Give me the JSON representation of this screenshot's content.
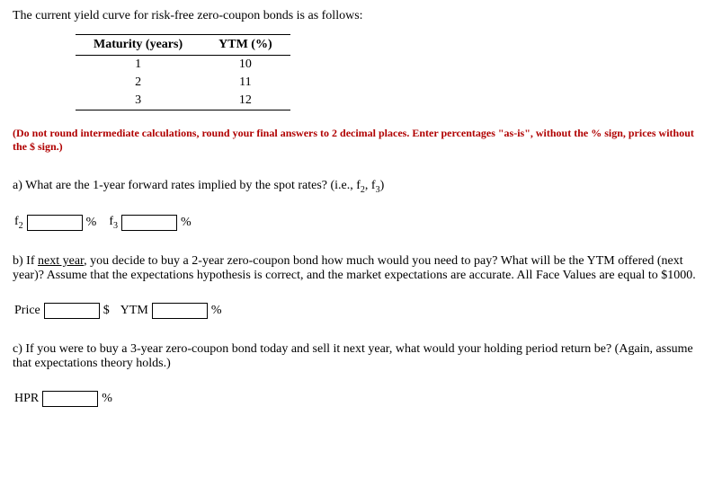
{
  "intro": "The current yield curve for risk-free zero-coupon bonds is as follows:",
  "table": {
    "headers": [
      "Maturity (years)",
      "YTM (%)"
    ],
    "rows": [
      {
        "m": "1",
        "y": "10"
      },
      {
        "m": "2",
        "y": "11"
      },
      {
        "m": "3",
        "y": "12"
      }
    ]
  },
  "warning": "(Do not round intermediate calculations, round your final answers to 2 decimal places. Enter percentages \"as-is\", without the % sign, prices without the $ sign.)",
  "qa": {
    "prefix": "a) What are the 1-year forward rates implied by the spot rates? (i.e., f",
    "sub2": "2",
    "mid": ", f",
    "sub3": "3",
    "suffix": ")"
  },
  "a_inputs": {
    "f2_label_f": "f",
    "f2_sub": "2",
    "pct1": "%",
    "f3_label_f": "f",
    "f3_sub": "3",
    "pct2": "%"
  },
  "qb": {
    "part1": "b) If ",
    "underline": "next year",
    "part2": ", you decide to buy a 2-year zero-coupon bond how much would you need to pay? What will be the YTM offered (next year)? Assume that the expectations hypothesis is correct, and the market expectations are accurate. All Face Values are equal to $1000."
  },
  "b_inputs": {
    "price_label": "Price",
    "dollar": "$",
    "ytm_label": "YTM",
    "pct": "%"
  },
  "qc": "c) If you were to buy a 3-year zero-coupon bond today and sell it next year, what would your holding period return be? (Again, assume that expectations theory holds.)",
  "c_inputs": {
    "hpr_label": "HPR",
    "pct": "%"
  }
}
